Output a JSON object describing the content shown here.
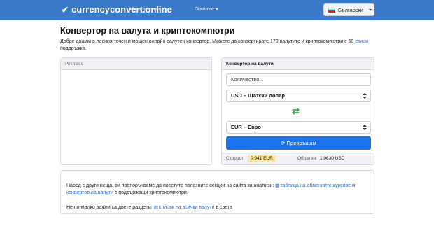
{
  "nav": {
    "brand": "currencyconvert.online",
    "menu_tools": "Инструменти",
    "menu_help": "Помогне",
    "language": "Български",
    "colors": {
      "bar": "#3b79c9",
      "flag": [
        "#ffffff",
        "#00966e",
        "#d62612"
      ]
    }
  },
  "page": {
    "title": "Конвертор на валута и криптокомпютри",
    "intro_text": "Добре дошли в лесния точен и мощен онлайн валутен конвертор. Можете да конвертирате 170 валутите и криптокомпютри с 60",
    "intro_link": "езици",
    "intro_tail": "поддръжка."
  },
  "ad": {
    "label": "Реклама"
  },
  "converter": {
    "header": "Конвертор на валути",
    "amount_placeholder": "Количество...",
    "from_currency": "USD – Щатски долар",
    "to_currency": "EUR – Евро",
    "convert_label": "Превръщам",
    "rate_label": "Скорост:",
    "rate_value": "0.941 EUR",
    "inverse_label": "Обратен:",
    "inverse_value": "1.0630 USD",
    "accent": "#1a73e8"
  },
  "info": {
    "p1_text": "Наред с други неща, ви препоръчваме да посетите полезните секции на сайта за анализи:",
    "p1_link1": "таблица на обменните курсове",
    "p1_and": "и",
    "p1_link2": "конвертор на валути",
    "p1_tail": "с поддържащи криптокомпютри.",
    "p2_text": "Не по-малко важни са двете раздели:",
    "p2_link": "списък на всички валути",
    "p2_tail": "в света"
  }
}
